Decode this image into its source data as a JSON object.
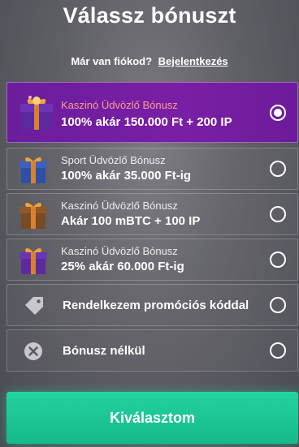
{
  "header": {
    "title": "Válassz bónuszt",
    "login_prompt": "Már van fiókod?",
    "login_link": "Bejelentkezés"
  },
  "options": [
    {
      "icon": "purple-gift-icon",
      "line1": "Kaszinó Üdvözlő Bónusz",
      "line2": "100% akár 150.000 Ft + 200 IP",
      "selected": true
    },
    {
      "icon": "blue-gift-icon",
      "line1": "Sport Üdvözlő Bónusz",
      "line2": "100% akár 35.000 Ft-ig",
      "selected": false
    },
    {
      "icon": "brown-gift-icon",
      "line1": "Kaszinó Üdvözlő Bónusz",
      "line2": "Akár 100 mBTC + 100 IP",
      "selected": false
    },
    {
      "icon": "purple-gift-icon",
      "line1": "Kaszinó Üdvözlő Bónusz",
      "line2": "25% akár 60.000 Ft-ig",
      "selected": false
    },
    {
      "icon": "tag-icon",
      "label": "Rendelkezem promóciós kóddal",
      "selected": false
    },
    {
      "icon": "close-circle-icon",
      "label": "Bónusz nélkül",
      "selected": false
    }
  ],
  "colors": {
    "selected_bg": "#6d1b9a",
    "selected_subtitle": "#ff9c8c",
    "cta": "#1ec596"
  },
  "cta": {
    "label": "Kiválasztom"
  }
}
